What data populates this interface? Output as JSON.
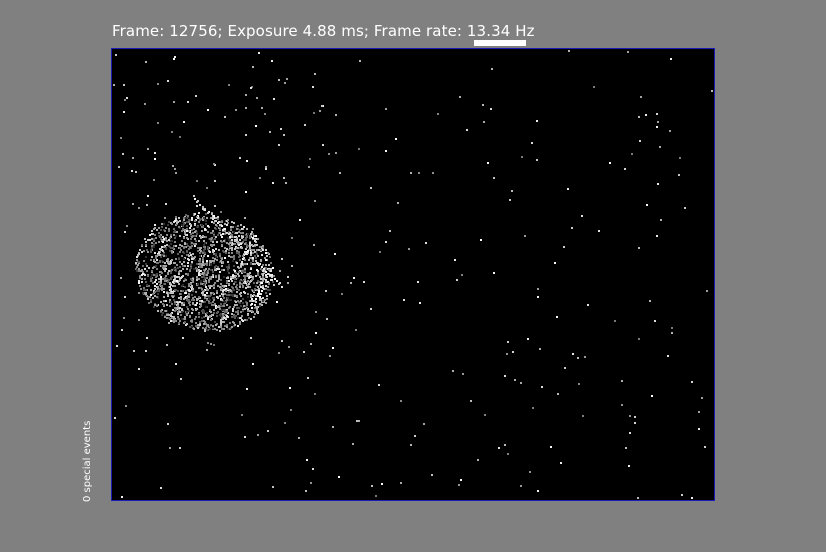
{
  "status": {
    "title": "Frame: 12756; Exposure 4.88 ms; Frame rate: 13.34 Hz"
  },
  "sidebar": {
    "special_events": "0 special events"
  },
  "colors": {
    "background": "#808080",
    "viewport_background": "#000000",
    "viewport_border": "#1a1ab8",
    "text": "#ffffff"
  }
}
